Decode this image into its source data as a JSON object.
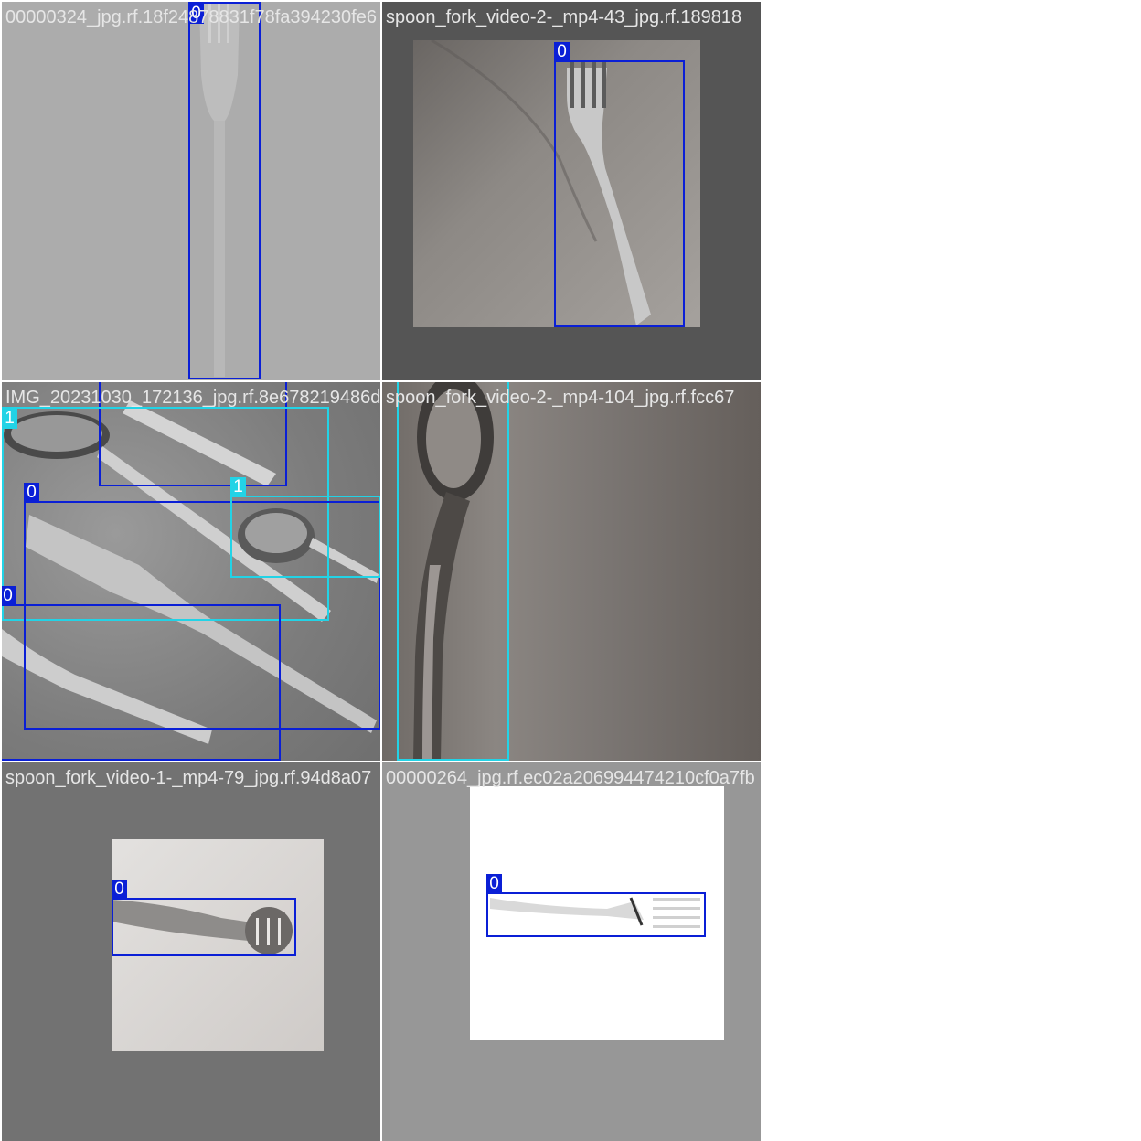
{
  "tiles": [
    {
      "filename": "00000324_jpg.rf.18f24878831f78fa394230fe6",
      "boxes": [
        {
          "cls": "0"
        }
      ]
    },
    {
      "filename": "spoon_fork_video-2-_mp4-43_jpg.rf.189818",
      "boxes": [
        {
          "cls": "0"
        }
      ]
    },
    {
      "filename": "IMG_20231030_172136_jpg.rf.8e678219486d",
      "boxes": [
        {
          "cls": "0"
        },
        {
          "cls": "1"
        },
        {
          "cls": "0"
        },
        {
          "cls": "1"
        },
        {
          "cls": "0"
        }
      ]
    },
    {
      "filename": "spoon_fork_video-2-_mp4-104_jpg.rf.fcc67",
      "boxes": [
        {
          "cls": "1"
        }
      ]
    },
    {
      "filename": "spoon_fork_video-1-_mp4-79_jpg.rf.94d8a07",
      "boxes": [
        {
          "cls": "0"
        }
      ]
    },
    {
      "filename": "00000264_jpg.rf.ec02a206994474210cf0a7fb",
      "boxes": [
        {
          "cls": "0"
        }
      ]
    }
  ],
  "colors": {
    "class_0": "#0a1fd6",
    "class_1": "#22d3e6",
    "label_text": "#e6e6e6"
  }
}
